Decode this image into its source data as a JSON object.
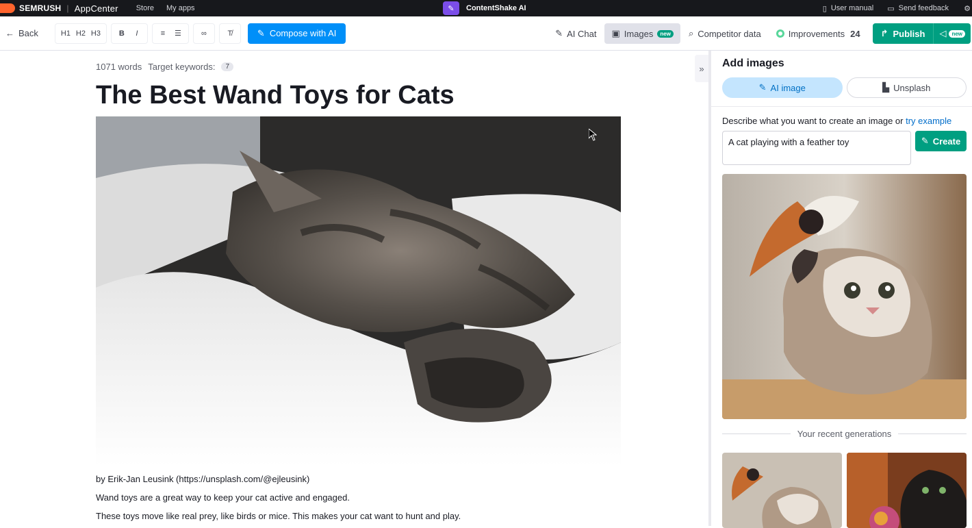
{
  "topbar": {
    "brand": "SEMRUSH",
    "appcenter": "AppCenter",
    "nav": [
      "Store",
      "My apps"
    ],
    "app_title": "ContentShake AI",
    "user_manual": "User manual",
    "send_feedback": "Send feedback"
  },
  "toolbar": {
    "back": "Back",
    "formatting": [
      "H1",
      "H2",
      "H3",
      "B",
      "I"
    ],
    "compose": "Compose with AI",
    "ai_chat": "AI Chat",
    "images": "Images",
    "new_badge": "new",
    "competitor": "Competitor data",
    "improvements": "Improvements",
    "improvements_count": "24",
    "publish": "Publish"
  },
  "editor": {
    "words": "1071 words",
    "target_keywords": "Target keywords:",
    "keyword_count": "7",
    "title": "The Best Wand Toys for Cats",
    "credit": "by Erik-Jan Leusink (https://unsplash.com/@ejleusink)",
    "p1": "Wand toys are a great way to keep your cat active and engaged.",
    "p2": "These toys move like real prey, like birds or mice. This makes your cat want to hunt and play."
  },
  "panel": {
    "title": "Add images",
    "tab_ai": "AI image",
    "tab_unsplash": "Unsplash",
    "describe": "Describe what you want to create an image or ",
    "try_example": "try example",
    "prompt_value": "A cat playing with a feather toy",
    "create": "Create",
    "recent": "Your recent generations"
  },
  "colors": {
    "accent_blue": "#008ff8",
    "accent_green": "#009f81",
    "brand_orange": "#ff642d"
  }
}
